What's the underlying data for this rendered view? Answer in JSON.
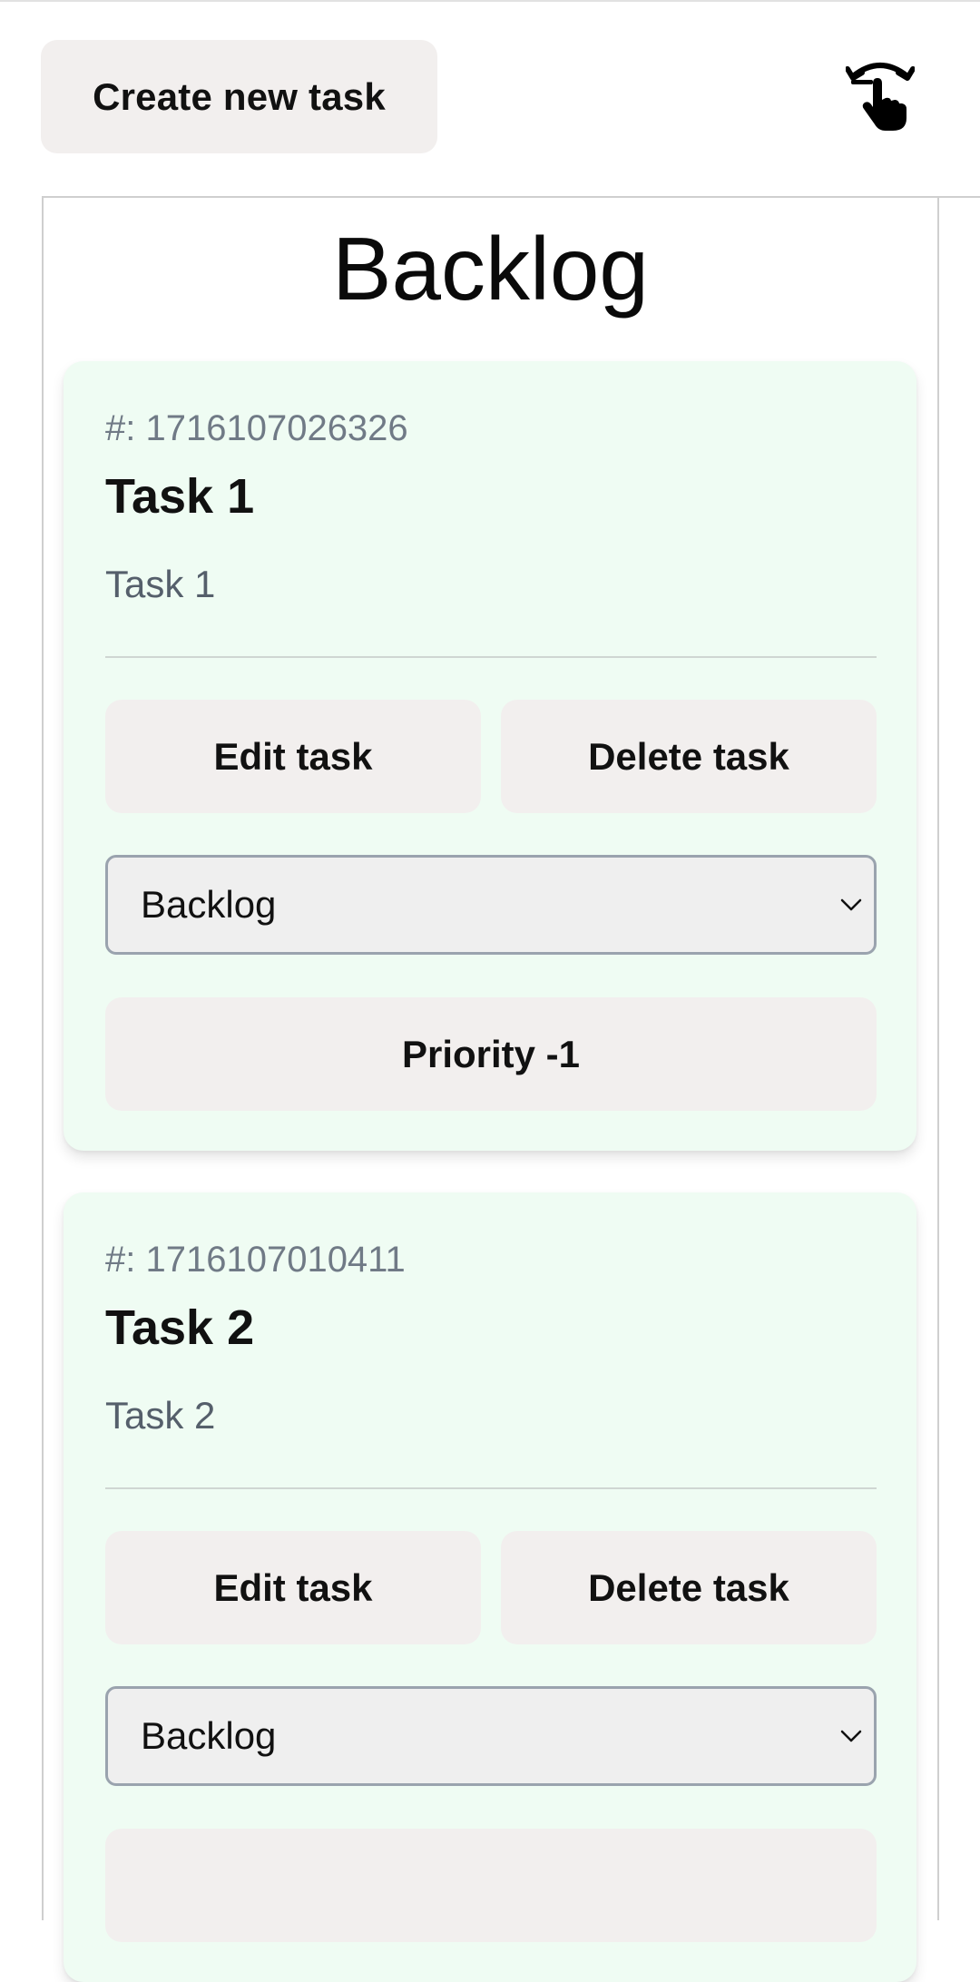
{
  "header": {
    "create_label": "Create new task",
    "drag_icon": "swipe-hand-icon"
  },
  "column": {
    "title": "Backlog"
  },
  "tasks": [
    {
      "id_text": "#: 1716107026326",
      "title": "Task 1",
      "description": "Task 1",
      "edit_label": "Edit task",
      "delete_label": "Delete task",
      "status": "Backlog",
      "priority_label": "Priority -1"
    },
    {
      "id_text": "#: 1716107010411",
      "title": "Task 2",
      "description": "Task 2",
      "edit_label": "Edit task",
      "delete_label": "Delete task",
      "status": "Backlog",
      "priority_label": ""
    }
  ],
  "colors": {
    "card_bg": "#effcf3",
    "button_bg": "#f2efee",
    "select_border": "#9aa3ae",
    "id_text": "#707a86",
    "desc_text": "#555f6b"
  }
}
